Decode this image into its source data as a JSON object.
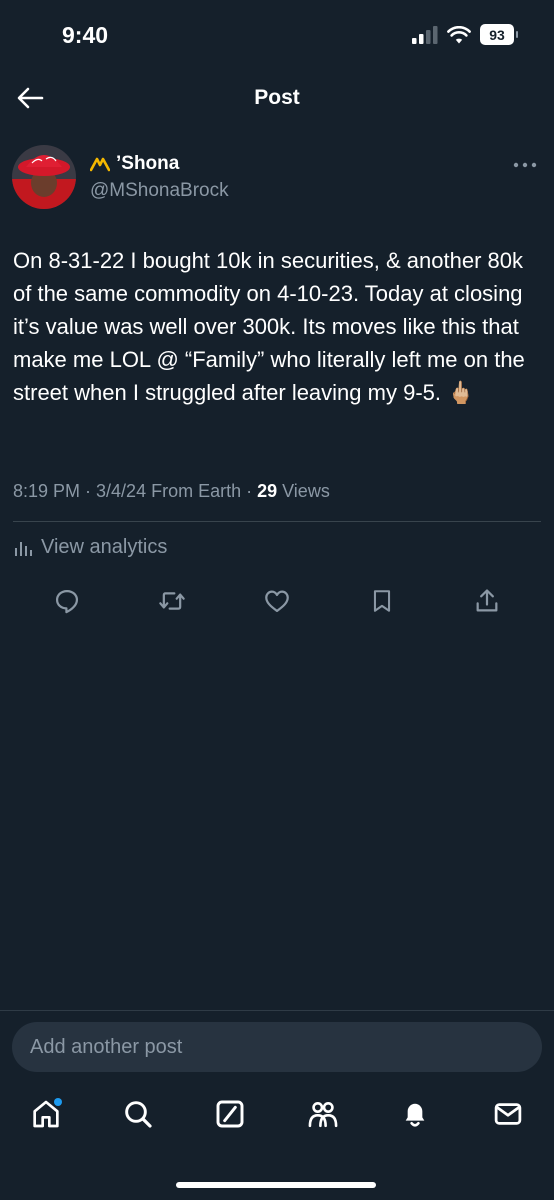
{
  "status_bar": {
    "time": "9:40",
    "battery": "93"
  },
  "header": {
    "title": "Post"
  },
  "author": {
    "emoji": "〽️",
    "name": "’Shona",
    "handle": "@MShonaBrock"
  },
  "post": {
    "text": "On 8-31-22 I bought 10k in securities, & another 80k of the same commodity on 4-10-23. Today at closing it’s value was well over 300k. Its moves like this that make me LOL @ “Family” who literally left me on the street when I struggled after leaving my 9-5. 🖕🏼",
    "meta_prefix": "8:19 PM · 3/4/24 From Earth · ",
    "views_count": "29",
    "views_label": " Views"
  },
  "analytics": {
    "label": "View analytics"
  },
  "compose": {
    "placeholder": "Add another post"
  },
  "colors": {
    "background": "#15202b",
    "accent": "#1d9bf0",
    "muted": "#8b98a5",
    "emoji_yellow": "#f5b800"
  },
  "icons": {
    "actions": [
      "reply-icon",
      "repost-icon",
      "like-icon",
      "bookmark-icon",
      "share-icon"
    ],
    "tabs": [
      "home-icon",
      "search-icon",
      "grok-icon",
      "communities-icon",
      "notifications-icon",
      "messages-icon"
    ]
  }
}
